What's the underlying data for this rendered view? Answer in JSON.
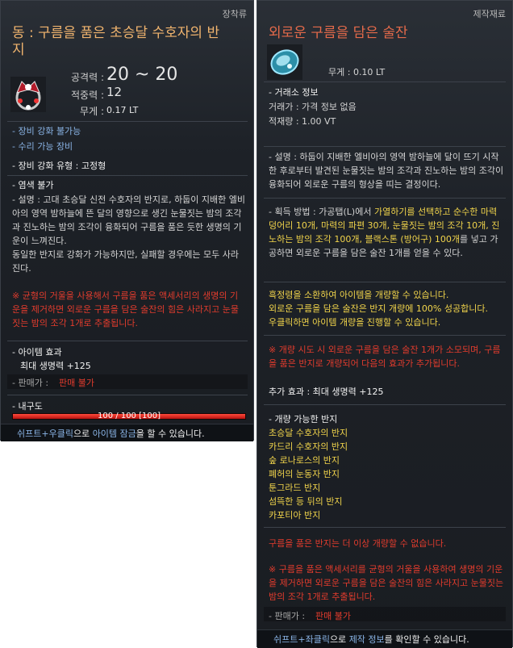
{
  "left": {
    "category": "장착류",
    "title": "동 : 구름을 품은 초승달 수호자의 반지",
    "stats": [
      {
        "label": "공격력 :",
        "value": "20 ~ 20"
      },
      {
        "label": "적중력 :",
        "value": "12"
      },
      {
        "label": "무게 :",
        "value": "0.17 LT"
      }
    ],
    "flags": [
      "- 장비 강화 불가능",
      "- 수리 가능 장비"
    ],
    "enhance_type": "- 장비 강화 유형 : 고정형",
    "dye": "- 염색 불가",
    "description": "- 설명 : 고대 초승달 신전 수호자의 반지로, 하둡이 지배한 엘비아의 영역 밤하늘에 뜬 달의 영향으로 생긴 눈물짓는 밤의 조각과 진노하는 밤의 조각이 융화되어 구름을 품은 듯한 생명의 기운이 느껴진다.",
    "description2": "동일한 반지로 강화가 가능하지만, 실패할 경우에는 모두 사라진다.",
    "warning": "※ 균형의 거울을 사용해서 구름을 품은 액세서리의 생명의 기운을 제거하면 외로운 구름을 담은 술잔의 힘은 사라지고 눈물짓는 밤의 조각 1개로 추출됩니다.",
    "effect_header": "- 아이템 효과",
    "effect": "최대 생명력 +125",
    "sale_label": "- 판매가 :",
    "sale_value": "판매 불가",
    "durability_label": "- 내구도",
    "durability_text": "100 / 100 [100]",
    "durability_ratio": 1.0,
    "hint_pre": "쉬프트+우클릭",
    "hint_mid": "으로 ",
    "hint_link": "아이템 잠금",
    "hint_post": "을 할 수 있습니다."
  },
  "right": {
    "category": "제작재료",
    "title": "외로운 구름을 담은 술잔",
    "weight": "무게 :   0.10 LT",
    "market_header": "- 거래소 정보",
    "market_price": "거래가 : 가격 정보 없음",
    "market_volume": "적재량 : 1.00 VT",
    "description": "- 설명 : 하둡이 지배한 엘비아의 영역 밤하늘에 달이 뜨기 시작한 후로부터 발견된 눈물짓는 밤의 조각과 진노하는 밤의 조각이 융화되어 외로운 구름의 형상을 띠는 결정이다.",
    "obtain_pre": "- 획득 방법 : 가공탭(L)에서 ",
    "obtain_y1": "가열하기를 선택하고 순수한 마력 덩어리 10개, 마력의 파편 30개, 눈물짓는 밤의 조각 10개, 진노하는 밤의 조각 100개, 블랙스톤 (방어구) 100개",
    "obtain_post": "를 넣고 가공하면 외로운 구름을 담은 술잔 1개를 얻을 수 있다.",
    "use1": "흑정령을 소환하여 아이템을 개량할 수 있습니다.",
    "use2": "외로운 구름을 담은 술잔은 반지 개량에 100% 성공합니다.",
    "use3": "우클릭하면 아이템 개량을 진행할 수 있습니다.",
    "warn1": "※ 개량 시도 시 외로운 구름을 담은 술잔 1개가 소모되며, 구름을 품은 반지로 개량되어 다음의 효과가 추가됩니다.",
    "extra_effect": "추가 효과 : 최대 생명력 +125",
    "list_header": "- 개량 가능한 반지",
    "rings": [
      "초승달 수호자의 반지",
      "카드리 수호자의 반지",
      "숲 로나로스의 반지",
      "폐허의 눈동자 반지",
      "툰그라드 반지",
      "섬뜩한 등 뒤의 반지",
      "카포티아 반지"
    ],
    "no_upgrade": "구름을 품은 반지는 더 이상 개량할 수 없습니다.",
    "warn2": "※ 구름을 품은 액세서리를 균형의 거울을 사용하여 생명의 기운을 제거하면 외로운 구름을 담은 술잔의 힘은 사라지고 눈물짓는 밤의 조각 1개로 추출됩니다.",
    "sale_label": "- 판매가 :",
    "sale_value": "판매 불가",
    "hint_pre": "쉬프트+좌클릭",
    "hint_mid": "으로 ",
    "hint_link": "제작 정보",
    "hint_post": "를 확인할 수 있습니다."
  },
  "colors": {
    "title": "#f0b46e",
    "warning": "#e23c2d",
    "highlight": "#f1d44b",
    "link": "#8ab4e6"
  }
}
